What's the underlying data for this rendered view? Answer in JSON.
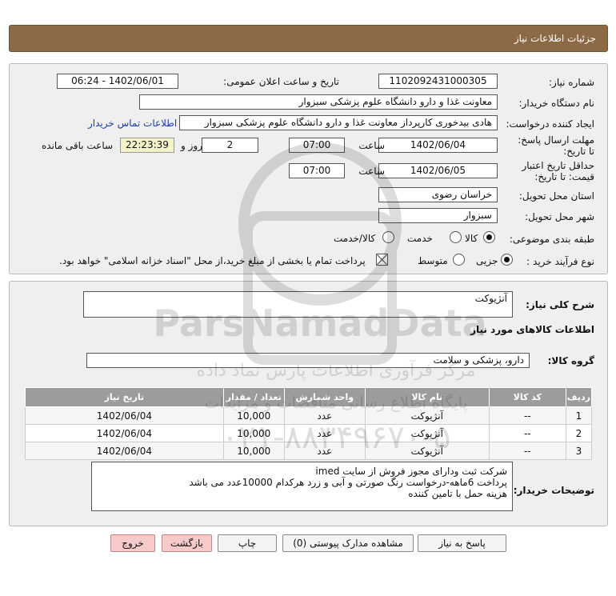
{
  "header": {
    "title": "جزئیات اطلاعات نیاز"
  },
  "form": {
    "need_number_label": "شماره نیاز:",
    "need_number": "1102092431000305",
    "announce_label": "تاریخ و ساعت اعلان عمومی:",
    "announce_value": "1402/06/01 - 06:24",
    "buyer_org_label": "نام دستگاه خریدار:",
    "buyer_org": "معاونت غذا و دارو   دانشگاه علوم پزشکی سبزوار",
    "creator_label": "ایجاد کننده درخواست:",
    "creator": "هادی بیدخوری کارپرداز معاونت غذا و دارو   دانشگاه علوم پزشکی سبزوار",
    "contact_link": "اطلاعات تماس خریدار",
    "deadline_label": "مهلت ارسال پاسخ: تا تاریخ:",
    "deadline_date": "1402/06/04",
    "time_label": "ساعت",
    "deadline_time": "07:00",
    "days_value": "2",
    "days_label": "روز و",
    "remaining_time": "22:23:39",
    "remaining_label": "ساعت باقی مانده",
    "validity_label": "حداقل تاریخ اعتبار قیمت: تا تاریخ:",
    "validity_date": "1402/06/05",
    "validity_time": "07:00",
    "province_label": "استان محل تحویل:",
    "province": "خراسان رضوی",
    "city_label": "شهر محل تحویل:",
    "city": "سبزوار",
    "category_label": "طبقه بندی موضوعی:",
    "category_options": [
      "کالا",
      "خدمت",
      "کالا/خدمت"
    ],
    "process_label": "نوع فرآیند خرید :",
    "process_options": [
      "جزیی",
      "متوسط"
    ],
    "payment_note": "پرداخت تمام یا بخشی از مبلغ خرید،از محل \"اسناد خزانه اسلامی\" خواهد بود."
  },
  "details": {
    "summary_label": "شرح کلی نیاز:",
    "summary": "آنژیوکت",
    "items_title": "اطلاعات کالاهای مورد نیاز",
    "group_label": "گروه کالا:",
    "group": "دارو، پزشکی و سلامت",
    "columns": [
      "ردیف",
      "کد کالا",
      "نام کالا",
      "واحد شمارش",
      "تعداد / مقدار",
      "تاریخ نیاز"
    ],
    "rows": [
      [
        "1",
        "--",
        "آنژیوکت",
        "عدد",
        "10,000",
        "1402/06/04"
      ],
      [
        "2",
        "--",
        "آنژیوکت",
        "عدد",
        "10,000",
        "1402/06/04"
      ],
      [
        "3",
        "--",
        "آنژیوکت",
        "عدد",
        "10,000",
        "1402/06/04"
      ]
    ],
    "buyer_notes_label": "توضیحات خریدار:",
    "buyer_notes": [
      "شرکت ثبت ودارای مجوز فروش از سایت imed",
      "پرداخت 6ماهه-درخواست رنگ صورتی و آبی و زرد هرکدام 10000عدد می باشد",
      "هزینه حمل با تامین کننده"
    ]
  },
  "buttons": {
    "reply": "پاسخ به نیاز",
    "attachments": "مشاهده مدارک پیوستی (0)",
    "print": "چاپ",
    "back": "بازگشت",
    "exit": "خروج"
  },
  "watermark": {
    "brand": "ParsNamadData",
    "line1": "مرکز فرآوری اطلاعات پارس نماد داده",
    "line2": "پایگاه اطلاع رسانی مناقصات و مزایدات",
    "phone": "۰۲۱-۸۸۳۴۹۶۷۰-۵"
  }
}
